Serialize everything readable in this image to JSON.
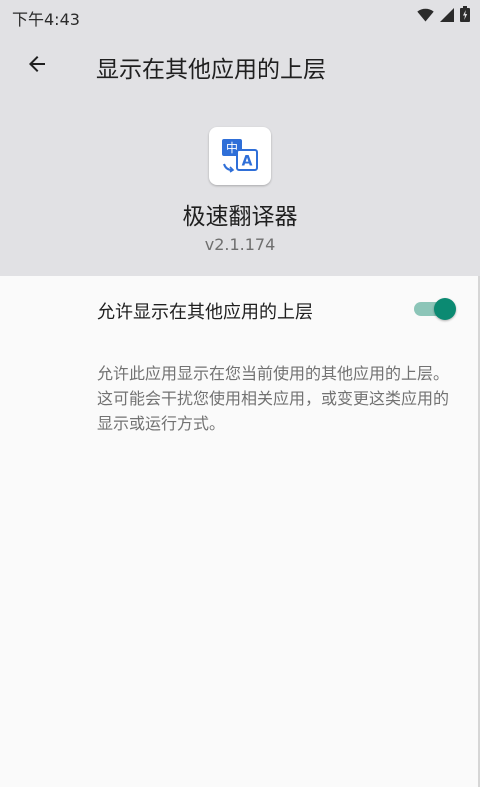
{
  "status_bar": {
    "time": "下午4:43",
    "icons": [
      "wifi-icon",
      "signal-icon",
      "battery-icon"
    ]
  },
  "toolbar": {
    "back_icon": "arrow-back-icon",
    "title": "显示在其他应用的上层"
  },
  "app": {
    "icon": "translate-app-icon",
    "name": "极速翻译器",
    "version": "v2.1.174"
  },
  "setting": {
    "label": "允许显示在其他应用的上层",
    "enabled": true
  },
  "description": "允许此应用显示在您当前使用的其他应用的上层。这可能会干扰您使用相关应用，或变更这类应用的显示或运行方式。",
  "colors": {
    "header_bg": "#e1e1e4",
    "body_bg": "#fafafa",
    "accent": "#0b8a72",
    "switch_track_on": "#8cc5b8",
    "app_icon_blue": "#2f6fd8"
  }
}
